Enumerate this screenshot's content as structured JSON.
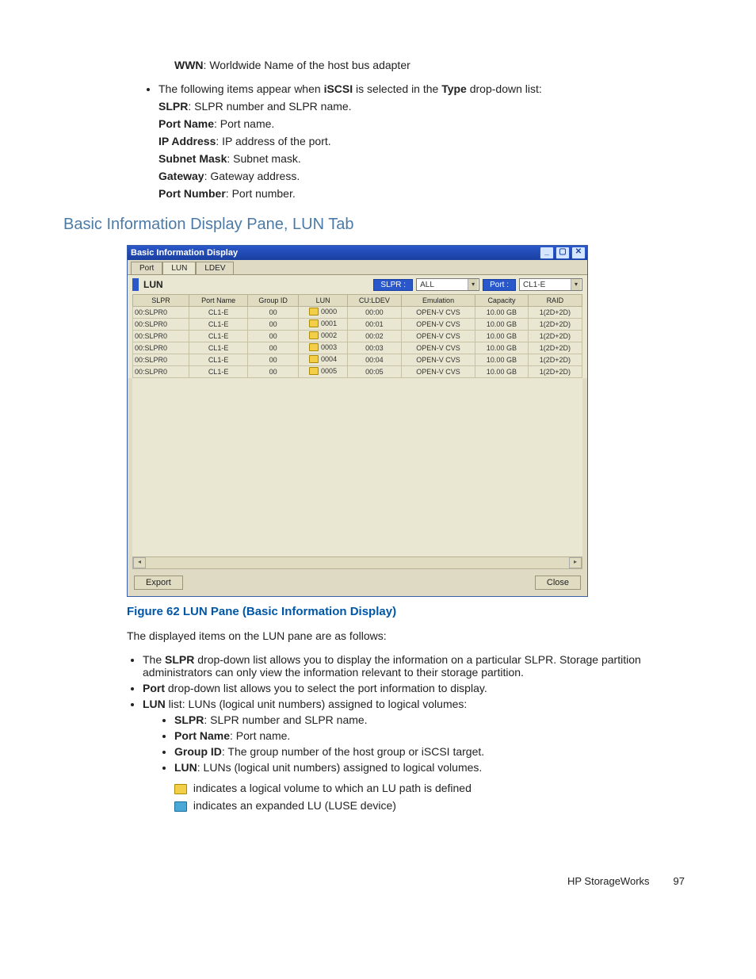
{
  "top_text": {
    "wwn_bold": "WWN",
    "wwn_rest": ": Worldwide Name of the host bus adapter",
    "bullet_lead_a": "The following items appear when ",
    "iscsi": "iSCSI",
    "bullet_lead_b": " is selected in the ",
    "type_b": "Type",
    "bullet_lead_c": " drop-down list:",
    "slpr_b": "SLPR",
    "slpr_t": ": SLPR number and SLPR name.",
    "pname_b": "Port Name",
    "pname_t": ": Port name.",
    "ip_b": "IP Address",
    "ip_t": ": IP address of the port.",
    "subnet_b": "Subnet Mask",
    "subnet_t": ": Subnet mask.",
    "gw_b": "Gateway",
    "gw_t": ": Gateway address.",
    "pnum_b": "Port Number",
    "pnum_t": ": Port number."
  },
  "section_heading": "Basic Information Display Pane, LUN Tab",
  "window": {
    "title": "Basic Information Display",
    "tabs": [
      "Port",
      "LUN",
      "LDEV"
    ],
    "active_tab_index": 1,
    "sub_label": "LUN",
    "slpr_label": "SLPR :",
    "slpr_value": "ALL",
    "port_label": "Port :",
    "port_value": "CL1-E",
    "columns": [
      "SLPR",
      "Port Name",
      "Group ID",
      "LUN",
      "CU:LDEV",
      "Emulation",
      "Capacity",
      "RAID"
    ],
    "rows": [
      {
        "slpr": "00:SLPR0",
        "port": "CL1-E",
        "gid": "00",
        "lun": "0000",
        "culdev": "00:00",
        "emu": "OPEN-V CVS",
        "cap": "10.00 GB",
        "raid": "1(2D+2D)"
      },
      {
        "slpr": "00:SLPR0",
        "port": "CL1-E",
        "gid": "00",
        "lun": "0001",
        "culdev": "00:01",
        "emu": "OPEN-V CVS",
        "cap": "10.00 GB",
        "raid": "1(2D+2D)"
      },
      {
        "slpr": "00:SLPR0",
        "port": "CL1-E",
        "gid": "00",
        "lun": "0002",
        "culdev": "00:02",
        "emu": "OPEN-V CVS",
        "cap": "10.00 GB",
        "raid": "1(2D+2D)"
      },
      {
        "slpr": "00:SLPR0",
        "port": "CL1-E",
        "gid": "00",
        "lun": "0003",
        "culdev": "00:03",
        "emu": "OPEN-V CVS",
        "cap": "10.00 GB",
        "raid": "1(2D+2D)"
      },
      {
        "slpr": "00:SLPR0",
        "port": "CL1-E",
        "gid": "00",
        "lun": "0004",
        "culdev": "00:04",
        "emu": "OPEN-V CVS",
        "cap": "10.00 GB",
        "raid": "1(2D+2D)"
      },
      {
        "slpr": "00:SLPR0",
        "port": "CL1-E",
        "gid": "00",
        "lun": "0005",
        "culdev": "00:05",
        "emu": "OPEN-V CVS",
        "cap": "10.00 GB",
        "raid": "1(2D+2D)"
      }
    ],
    "export_btn": "Export",
    "close_btn": "Close"
  },
  "figure_caption": "Figure 62 LUN Pane (Basic Information Display)",
  "body": {
    "intro": "The displayed items on the LUN pane are as follows:",
    "b1_a": "The ",
    "b1_bold": "SLPR",
    "b1_b": " drop-down list allows you to display the information on a particular SLPR. Storage partition administrators can only view the information relevant to their storage partition.",
    "b2_bold": "Port",
    "b2_t": " drop-down list allows you to select the port information to display.",
    "b3_bold": "LUN",
    "b3_t": " list: LUNs (logical unit numbers) assigned to logical volumes:",
    "s1_b": "SLPR",
    "s1_t": ": SLPR number and SLPR name.",
    "s2_b": "Port Name",
    "s2_t": ": Port name.",
    "s3_b": "Group ID",
    "s3_t": ": The group number of the host group or iSCSI target.",
    "s4_b": "LUN",
    "s4_t": ": LUNs (logical unit numbers) assigned to logical volumes.",
    "ico1_text": " indicates a logical volume to which an LU path is defined",
    "ico2_text": " indicates an expanded LU (LUSE device)"
  },
  "footer": {
    "brand": "HP StorageWorks",
    "page": "97"
  }
}
